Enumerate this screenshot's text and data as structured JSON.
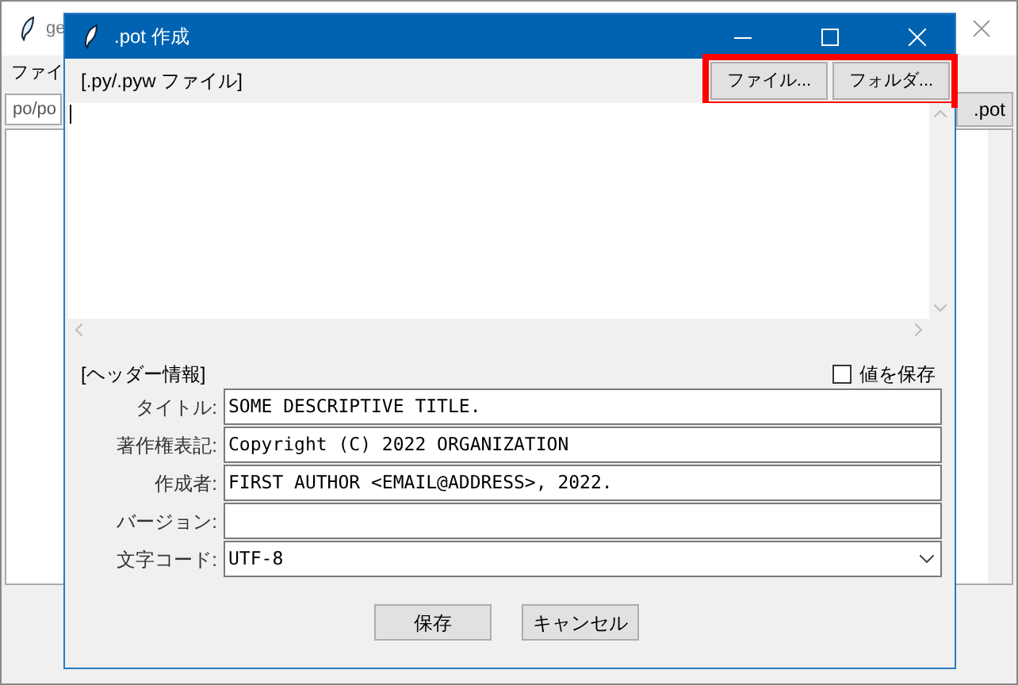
{
  "background_window": {
    "title": "ge",
    "menu": "ファイ",
    "field": "po/po",
    "button": ".pot"
  },
  "dialog": {
    "title": ".pot 作成",
    "files_label": "[.py/.pyw ファイル]",
    "pick_buttons_highlighted": true,
    "pick_buttons": [
      {
        "label": "ファイル..."
      },
      {
        "label": "フォルダ..."
      }
    ],
    "header_label": "[ヘッダー情報]",
    "save_values": {
      "label": "値を保存",
      "checked": false
    },
    "fields": [
      {
        "label": "タイトル:",
        "value": "SOME DESCRIPTIVE TITLE.",
        "kind": "text"
      },
      {
        "label": "著作権表記:",
        "value": "Copyright (C) 2022 ORGANIZATION",
        "kind": "text"
      },
      {
        "label": "作成者:",
        "value": "FIRST AUTHOR <EMAIL@ADDRESS>, 2022.",
        "kind": "text"
      },
      {
        "label": "バージョン:",
        "kind": "text"
      },
      {
        "label": "文字コード:",
        "value": "UTF-8",
        "kind": "dropdown"
      }
    ],
    "buttons": [
      "保存",
      "キャンセル"
    ]
  }
}
